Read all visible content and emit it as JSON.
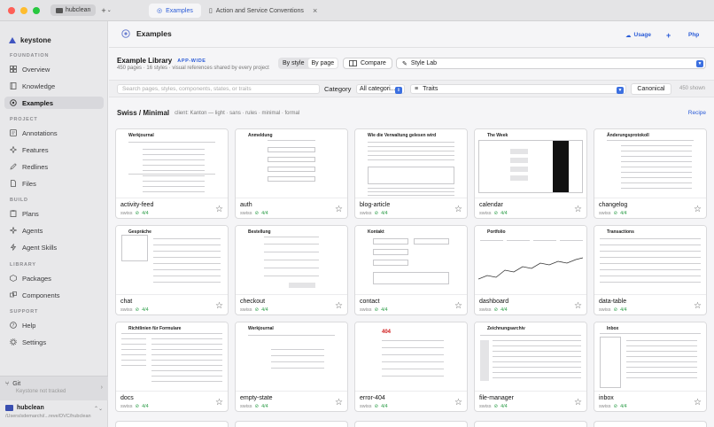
{
  "titlebar": {
    "workspace": "hubclean",
    "tabs": [
      {
        "label": "Examples",
        "active": true
      },
      {
        "label": "Action and Service Conventions",
        "active": false
      }
    ]
  },
  "sidebar": {
    "brand": "keystone",
    "sections": {
      "foundation": "FOUNDATION",
      "project": "PROJECT",
      "build": "BUILD",
      "library": "LIBRARY",
      "support": "SUPPORT"
    },
    "items": [
      {
        "label": "Overview"
      },
      {
        "label": "Knowledge"
      },
      {
        "label": "Examples"
      },
      {
        "label": "Annotations"
      },
      {
        "label": "Features"
      },
      {
        "label": "Redlines"
      },
      {
        "label": "Files"
      },
      {
        "label": "Plans"
      },
      {
        "label": "Agents"
      },
      {
        "label": "Agent Skills"
      },
      {
        "label": "Packages"
      },
      {
        "label": "Components"
      },
      {
        "label": "Help"
      },
      {
        "label": "Settings"
      }
    ],
    "git": {
      "label": "Git",
      "status": "Keystone not tracked"
    },
    "project": {
      "name": "hubclean",
      "path": "/Users/sdemarchi/...reve/DVC/hubclean"
    }
  },
  "header": {
    "title": "Examples",
    "usage": "Usage",
    "plus": "+",
    "php": "Php"
  },
  "library": {
    "title": "Example Library",
    "badge": "APP-WIDE",
    "subtitle": "450 pages · 16 styles · visual references shared by every project",
    "by_style": "By style",
    "by_page": "By page",
    "compare": "Compare",
    "style_lab": "Style Lab"
  },
  "filters": {
    "search_placeholder": "Search pages, styles, components, states, or traits",
    "category_label": "Category",
    "category_value": "All categori...",
    "traits": "Traits",
    "canonical": "Canonical",
    "shown": "450 shown"
  },
  "group": {
    "title": "Swiss / Minimal",
    "meta": "client: Kanton — light · sans · rules · minimal · formal",
    "recipe": "Recipe"
  },
  "cards": [
    {
      "name": "activity-feed",
      "style": "swiss",
      "score": "4/4",
      "thumb_title": "Werkjournal"
    },
    {
      "name": "auth",
      "style": "swiss",
      "score": "4/4",
      "thumb_title": "Anmeldung"
    },
    {
      "name": "blog-article",
      "style": "swiss",
      "score": "4/4",
      "thumb_title": "Wie die Verwaltung gelesen wird"
    },
    {
      "name": "calendar",
      "style": "swiss",
      "score": "4/4",
      "thumb_title": "The Week"
    },
    {
      "name": "changelog",
      "style": "swiss",
      "score": "4/4",
      "thumb_title": "Änderungsprotokoll"
    },
    {
      "name": "chat",
      "style": "swiss",
      "score": "4/4",
      "thumb_title": "Gespräche"
    },
    {
      "name": "checkout",
      "style": "swiss",
      "score": "4/4",
      "thumb_title": "Bestellung"
    },
    {
      "name": "contact",
      "style": "swiss",
      "score": "4/4",
      "thumb_title": "Kontakt"
    },
    {
      "name": "dashboard",
      "style": "swiss",
      "score": "4/4",
      "thumb_title": "Portfolio"
    },
    {
      "name": "data-table",
      "style": "swiss",
      "score": "4/4",
      "thumb_title": "Transactions"
    },
    {
      "name": "docs",
      "style": "swiss",
      "score": "4/4",
      "thumb_title": "Richtlinien für Formulare"
    },
    {
      "name": "empty-state",
      "style": "swiss",
      "score": "4/4",
      "thumb_title": "Werkjournal"
    },
    {
      "name": "error-404",
      "style": "swiss",
      "score": "4/4",
      "thumb_title": "404"
    },
    {
      "name": "file-manager",
      "style": "swiss",
      "score": "4/4",
      "thumb_title": "Zeichnungsarchiv"
    },
    {
      "name": "inbox",
      "style": "swiss",
      "score": "4/4",
      "thumb_title": "Inbox"
    }
  ],
  "colors": {
    "accent": "#2a5bd7",
    "ok": "#2e9e4a",
    "traffic_red": "#fe5f57",
    "traffic_yellow": "#febc2e",
    "traffic_green": "#28c840"
  }
}
